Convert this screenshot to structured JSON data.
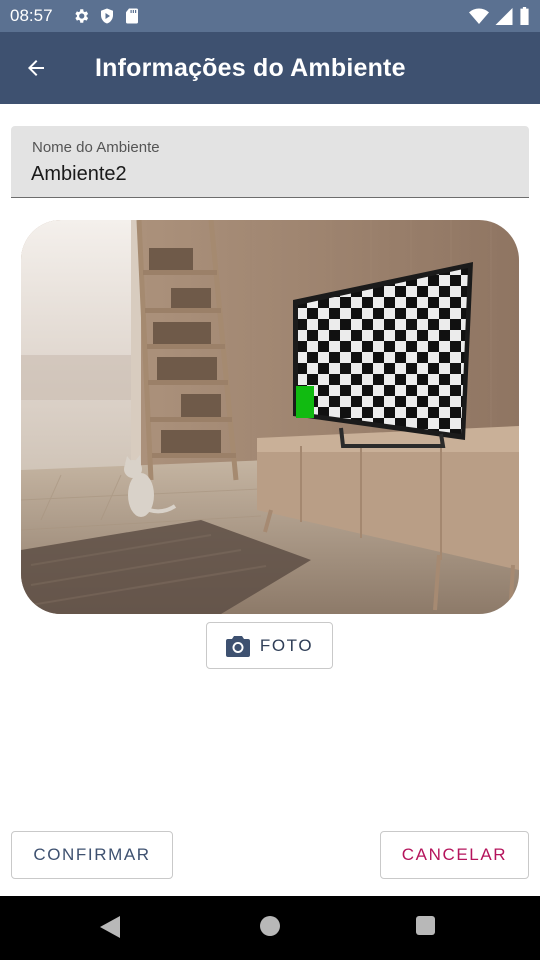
{
  "status_bar": {
    "time": "08:57",
    "icons_left": [
      "gear-icon",
      "shield-play-icon",
      "sd-card-icon"
    ],
    "icons_right": [
      "wifi-icon",
      "signal-icon",
      "battery-icon"
    ]
  },
  "app_bar": {
    "title": "Informações do Ambiente",
    "back_icon": "arrow-left-icon"
  },
  "form": {
    "name_label": "Nome do Ambiente",
    "name_value": "Ambiente2"
  },
  "room_image": {
    "description_icon": "room-photo"
  },
  "buttons": {
    "photo_label": "FOTO",
    "photo_icon": "camera-icon",
    "confirm_label": "CONFIRMAR",
    "cancel_label": "CANCELAR"
  },
  "colors": {
    "status_bar": "#5b7191",
    "app_bar": "#3e5170",
    "cancel_text": "#b5145c",
    "confirm_text": "#3e5170"
  },
  "nav_bar": {
    "icons": [
      "nav-back-icon",
      "nav-home-icon",
      "nav-recent-icon"
    ]
  }
}
